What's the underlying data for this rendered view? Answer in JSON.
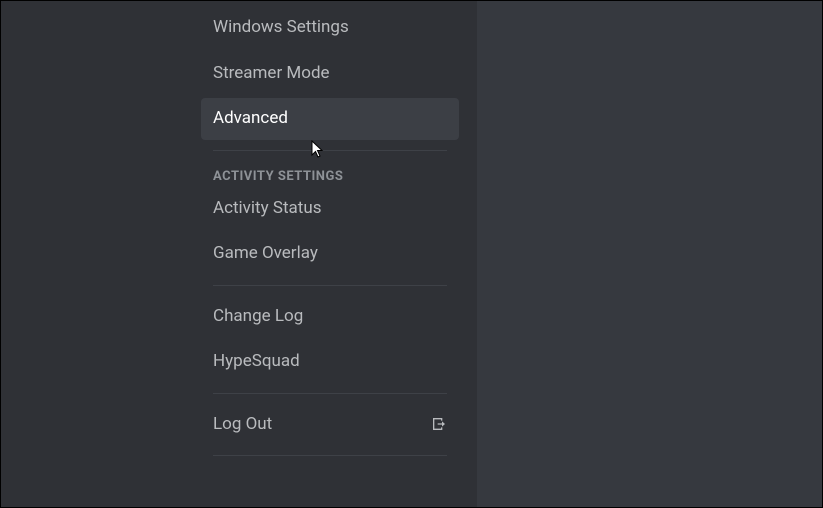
{
  "sidebar": {
    "items": [
      {
        "label": "Windows Settings"
      },
      {
        "label": "Streamer Mode"
      },
      {
        "label": "Advanced"
      }
    ],
    "activity_header": "ACTIVITY SETTINGS",
    "activity_items": [
      {
        "label": "Activity Status"
      },
      {
        "label": "Game Overlay"
      }
    ],
    "misc_items": [
      {
        "label": "Change Log"
      },
      {
        "label": "HypeSquad"
      }
    ],
    "logout": {
      "label": "Log Out"
    }
  }
}
